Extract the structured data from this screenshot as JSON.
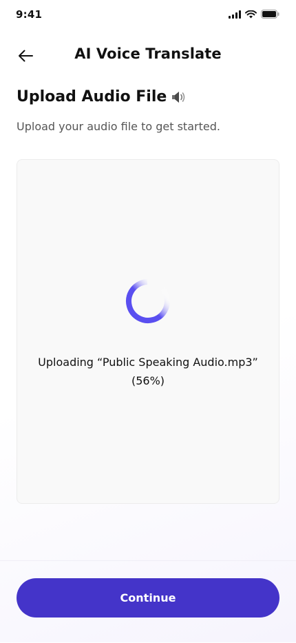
{
  "status_bar": {
    "time": "9:41"
  },
  "header": {
    "title": "AI Voice Translate",
    "back_icon": "arrow-left-icon"
  },
  "section": {
    "title": "Upload Audio File",
    "title_icon": "speaker-icon",
    "subtitle": "Upload your audio file to get started."
  },
  "upload": {
    "status_line1": "Uploading “Public Speaking Audio.mp3”",
    "status_line2": "(56%)",
    "progress": 0.56
  },
  "footer": {
    "continue_label": "Continue"
  },
  "colors": {
    "accent": "#4434c9",
    "spinner": "#5a4ff0"
  }
}
